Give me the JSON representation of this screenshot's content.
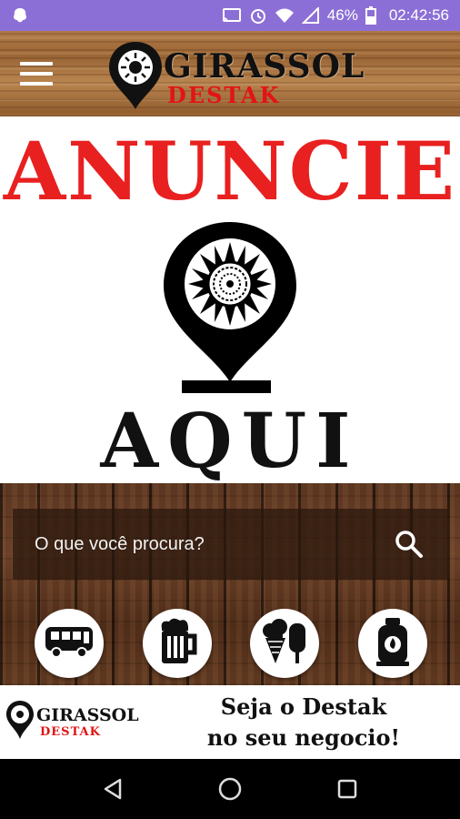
{
  "status_bar": {
    "battery_percent": "46%",
    "time": "02:42:56"
  },
  "header": {
    "brand": "GIRASSOL",
    "sub": "DESTAK",
    "menu_icon": "hamburger-menu-icon"
  },
  "banner": {
    "title": "ANUNCIE",
    "aqui": "AQUI"
  },
  "search": {
    "placeholder": "O que você procura?",
    "icon": "search-icon"
  },
  "categories": [
    {
      "icon": "bus-icon"
    },
    {
      "icon": "beer-mug-icon"
    },
    {
      "icon": "ice-cream-icon"
    },
    {
      "icon": "gas-cylinder-icon"
    }
  ],
  "footer_ad": {
    "brand": "GIRASSOL",
    "sub": "DESTAK",
    "tagline_line1": "Seja o Destak",
    "tagline_line2": "no seu negocio!"
  },
  "colors": {
    "status_bar": "#8c6fd6",
    "accent_red": "#e82020",
    "dark_text": "#111111"
  }
}
